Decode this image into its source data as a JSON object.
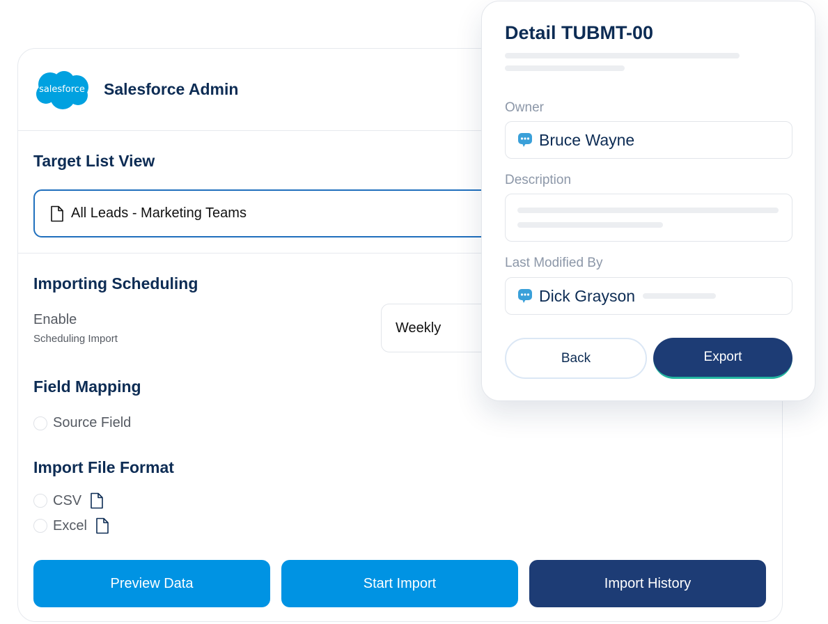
{
  "app": {
    "logo_text": "salesforce",
    "title": "Salesforce Admin"
  },
  "target": {
    "title": "Target List View",
    "value": "All Leads - Marketing Teams"
  },
  "scheduling": {
    "title": "Importing Scheduling",
    "enable_label": "Enable",
    "enable_sub": "Scheduling Import",
    "frequency": "Weekly"
  },
  "mapping": {
    "title": "Field Mapping",
    "source_field": "Source Field"
  },
  "format": {
    "title": "Import File Format",
    "options": [
      "CSV",
      "Excel"
    ]
  },
  "actions": {
    "preview": "Preview Data",
    "start": "Start Import",
    "history": "Import History"
  },
  "detail": {
    "title": "Detail TUBMT-00",
    "owner_label": "Owner",
    "owner": "Bruce Wayne",
    "description_label": "Description",
    "modified_label": "Last Modified By",
    "modified_by": "Dick Grayson",
    "back": "Back",
    "export": "Export"
  },
  "colors": {
    "navy": "#1d3c75",
    "blue": "#0093e3",
    "title": "#0d2c54",
    "salesforce_blue": "#00a1e0",
    "chat_icon": "#3aa0d9"
  }
}
